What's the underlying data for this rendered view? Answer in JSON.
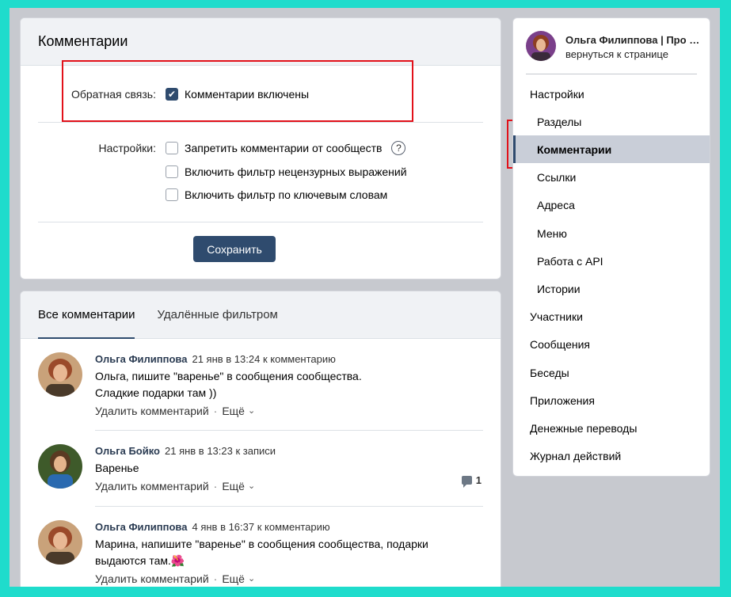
{
  "settings_card": {
    "title": "Комментарии",
    "feedback_label": "Обратная связь:",
    "feedback_option": "Комментарии включены",
    "settings_label": "Настройки:",
    "options": [
      "Запретить комментарии от сообществ",
      "Включить фильтр нецензурных выражений",
      "Включить фильтр по ключевым словам"
    ],
    "help_glyph": "?",
    "save_label": "Сохранить"
  },
  "comments_card": {
    "tabs": [
      "Все комментарии",
      "Удалённые фильтром"
    ],
    "comments": [
      {
        "author": "Ольга Филиппова",
        "meta": "21 янв в 13:24 к комментарию",
        "lines": [
          "Ольга, пишите \"варенье\" в сообщения сообщества.",
          "Сладкие подарки там ))"
        ],
        "delete_label": "Удалить комментарий",
        "more_label": "Ещё"
      },
      {
        "author": "Ольга Бойко",
        "meta": "21 янв в 13:23 к записи",
        "lines": [
          "Варенье"
        ],
        "delete_label": "Удалить комментарий",
        "more_label": "Ещё",
        "reply_count": "1"
      },
      {
        "author": "Ольга Филиппова",
        "meta": "4 янв в 16:37 к комментарию",
        "lines": [
          "Марина, напишите \"варенье\" в сообщения сообщества, подарки",
          "выдаются там.🌺"
        ],
        "delete_label": "Удалить комментарий",
        "more_label": "Ещё"
      }
    ]
  },
  "nav": {
    "owner_name": "Ольга Филиппова | Про у...",
    "owner_back": "вернуться к странице",
    "items": [
      {
        "label": "Настройки",
        "level": "top"
      },
      {
        "label": "Разделы",
        "level": "sub"
      },
      {
        "label": "Комментарии",
        "level": "sub",
        "active": true
      },
      {
        "label": "Ссылки",
        "level": "sub"
      },
      {
        "label": "Адреса",
        "level": "sub"
      },
      {
        "label": "Меню",
        "level": "sub"
      },
      {
        "label": "Работа с API",
        "level": "sub"
      },
      {
        "label": "Истории",
        "level": "sub"
      },
      {
        "label": "Участники",
        "level": "top"
      },
      {
        "label": "Сообщения",
        "level": "top"
      },
      {
        "label": "Беседы",
        "level": "top"
      },
      {
        "label": "Приложения",
        "level": "top"
      },
      {
        "label": "Денежные переводы",
        "level": "top"
      },
      {
        "label": "Журнал действий",
        "level": "top"
      }
    ]
  },
  "colors": {
    "outer_border": "#1fdccc",
    "accent": "#2f4b6e",
    "highlight_box": "#e2111a"
  }
}
